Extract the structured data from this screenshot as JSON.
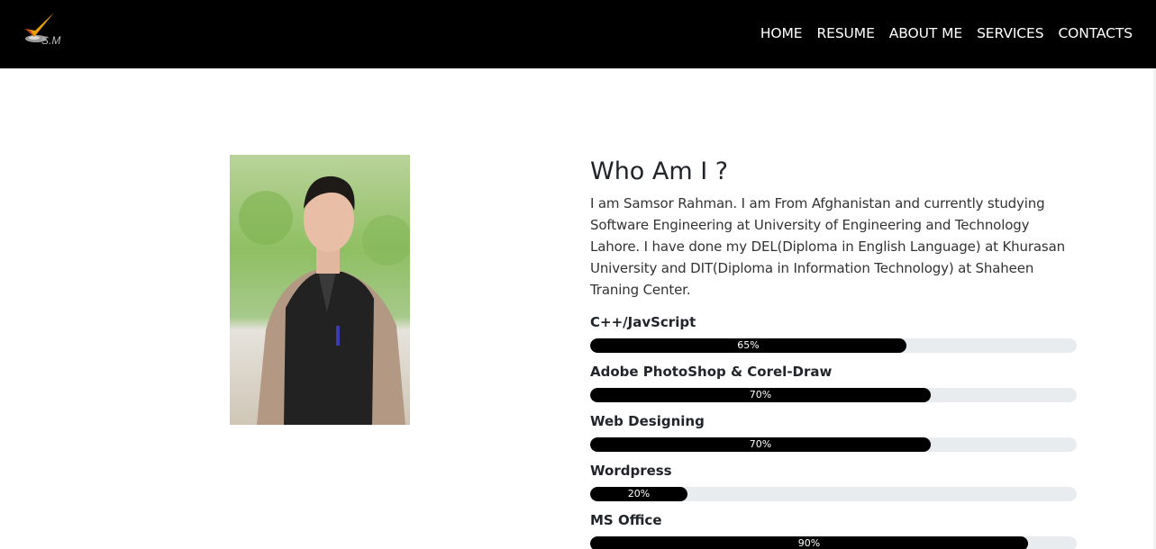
{
  "header": {
    "logo_text": "S.M",
    "nav_items": [
      {
        "label": "HOME"
      },
      {
        "label": "RESUME"
      },
      {
        "label": "ABOUT ME"
      },
      {
        "label": "SERVICES"
      },
      {
        "label": "CONTACTS"
      }
    ]
  },
  "about": {
    "title": "Who Am I ?",
    "bio": "I am Samsor Rahman. I am From Afghanistan and currently studying Software Engineering at University of Engineering and Technology Lahore. I have done my DEL(Diploma in English Language) at Khurasan University and DIT(Diploma in Information Technology) at Shaheen Traning Center."
  },
  "skills": [
    {
      "name": "C++/JavScript",
      "percent": 65,
      "percent_label": "65%"
    },
    {
      "name": "Adobe PhotoShop & Corel-Draw",
      "percent": 70,
      "percent_label": "70%"
    },
    {
      "name": "Web Designing",
      "percent": 70,
      "percent_label": "70%"
    },
    {
      "name": "Wordpress",
      "percent": 20,
      "percent_label": "20%"
    },
    {
      "name": "MS Office",
      "percent": 90,
      "percent_label": "90%"
    }
  ],
  "colors": {
    "nav_bg": "#000000",
    "bar_fill": "#000000",
    "bar_track": "#e9ecef",
    "logo_accent": "#e8a000"
  }
}
